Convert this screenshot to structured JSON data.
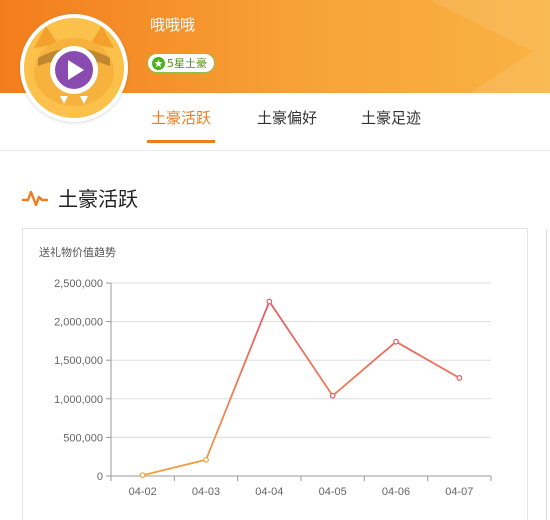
{
  "header": {
    "username": "哦哦哦",
    "badge_label": "5星土豪",
    "colors": {
      "band_left": "#f37d1d",
      "band_right": "#f9b343",
      "accent": "#f07c1c",
      "badge_green": "#4caf1c"
    }
  },
  "tabs": [
    {
      "label": "土豪活跃",
      "active": true
    },
    {
      "label": "土豪偏好",
      "active": false
    },
    {
      "label": "土豪足迹",
      "active": false
    }
  ],
  "section": {
    "title": "土豪活跃",
    "icon": "pulse-icon"
  },
  "chart_data": {
    "type": "line",
    "title": "送礼物价值趋势",
    "categories": [
      "04-02",
      "04-03",
      "04-04",
      "04-05",
      "04-06",
      "04-07"
    ],
    "values": [
      10000,
      210000,
      2260000,
      1040000,
      1740000,
      1270000
    ],
    "ylim": [
      0,
      2500000
    ],
    "yticks": [
      "0",
      "500,000",
      "1,000,000",
      "1,500,000",
      "2,000,000",
      "2,500,000"
    ],
    "grid": true,
    "line_colors": {
      "start": "#f0a040",
      "end": "#e85a6a"
    }
  }
}
